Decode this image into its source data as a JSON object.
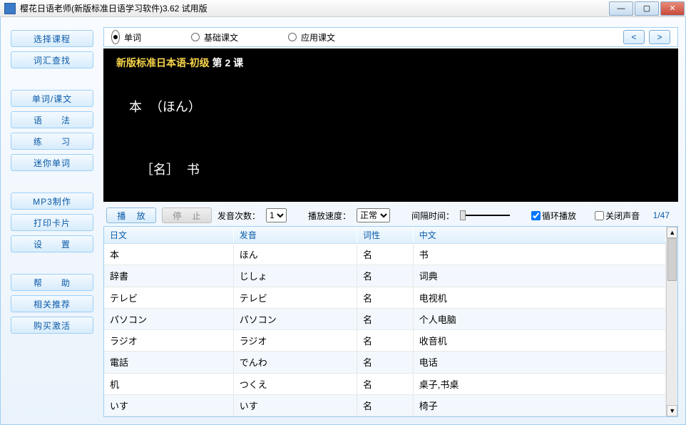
{
  "window": {
    "title": "樱花日语老师(新版标准日语学习软件)3.62 试用版"
  },
  "sidebar": {
    "groups": [
      [
        "选择课程",
        "词汇查找"
      ],
      [
        "单词/课文",
        "语　　法",
        "练　　习",
        "迷你单词"
      ],
      [
        "MP3制作",
        "打印卡片",
        "设　　置"
      ],
      [
        "帮　　助",
        "相关推荐",
        "购买激活"
      ]
    ]
  },
  "radios": {
    "opt1": "单词",
    "opt2": "基础课文",
    "opt3": "应用课文",
    "selected": "opt1"
  },
  "lesson": {
    "title_yellow": "新版标准日本语-初级",
    "title_white": "  第  2  课",
    "word_jp": "本 （ほん）",
    "word_def": "［名］ 书"
  },
  "controls": {
    "play": "播  放",
    "stop": "停  止",
    "count_label": "发音次数：",
    "count_value": "1",
    "speed_label": "播放速度：",
    "speed_value": "正常",
    "interval_label": "间隔时间：",
    "loop": "循环播放",
    "mute": "关闭声音",
    "counter": "1/47",
    "loop_checked": true,
    "mute_checked": false
  },
  "table": {
    "headers": [
      "日文",
      "发音",
      "词性",
      "中文"
    ],
    "rows": [
      [
        "本",
        "ほん",
        "名",
        "书"
      ],
      [
        "辞書",
        "じしょ",
        "名",
        "词典"
      ],
      [
        "テレビ",
        "テレビ",
        "名",
        "电视机"
      ],
      [
        "パソコン",
        "パソコン",
        "名",
        "个人电脑"
      ],
      [
        "ラジオ",
        "ラジオ",
        "名",
        "收音机"
      ],
      [
        "電話",
        "でんわ",
        "名",
        "电话"
      ],
      [
        "机",
        "つくえ",
        "名",
        "桌子,书桌"
      ],
      [
        "いす",
        "いす",
        "名",
        "椅子"
      ]
    ]
  }
}
